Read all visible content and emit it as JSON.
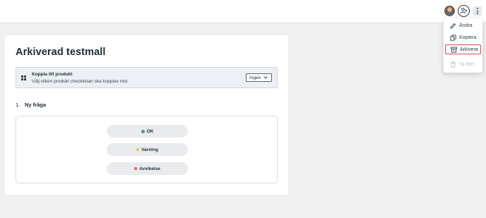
{
  "header": {
    "avatar_icon": "user-avatar",
    "add_user_icon": "add-user-icon",
    "more_icon": "more-vertical-icon"
  },
  "menu": {
    "items": [
      {
        "label": "Ändra",
        "icon": "pencil-icon"
      },
      {
        "label": "Kopiera",
        "icon": "copy-icon"
      },
      {
        "label": "Arkivera",
        "icon": "archive-icon",
        "highlighted": true
      },
      {
        "label": "Ta bort",
        "icon": "trash-icon",
        "disabled": true
      }
    ]
  },
  "template": {
    "title": "Arkiverad testmall",
    "product": {
      "title": "Koppla till produkt",
      "subtitle": "Välj vilken produkt checklistan ska kopplas mot",
      "select_value": "Ingen"
    },
    "question": {
      "number": "1.",
      "label": "Ny fråga",
      "answers": [
        {
          "label": "OK",
          "color": "#3aa876"
        },
        {
          "label": "Varning",
          "color": "#f2c230"
        },
        {
          "label": "Avvikelse",
          "color": "#ee6a6a"
        }
      ]
    }
  },
  "colors": {
    "highlight_border": "#e04545",
    "background": "#f0f0f0"
  }
}
